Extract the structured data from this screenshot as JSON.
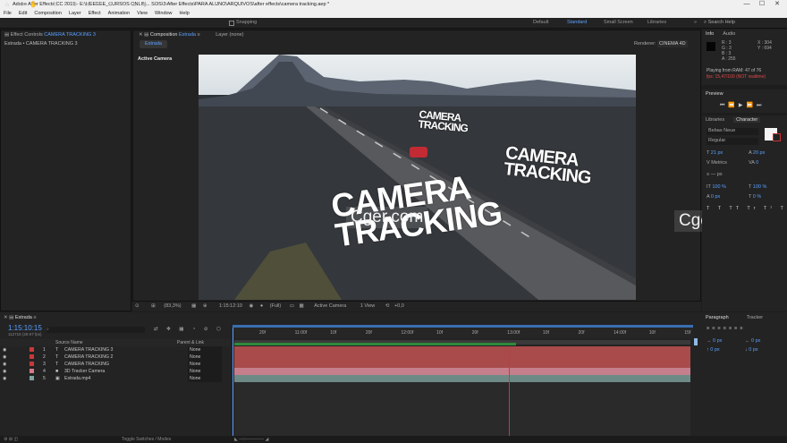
{
  "window": {
    "title": "Adobe After Effects CC 2019 - E:\\HEEEEE_CURSOS ONLIN... SOS\\3 After Effects\\PARA ALUNO\\ARQUIVOS\\after effects\\camera tracking.aep *",
    "logo": "Ae",
    "min": "—",
    "max": "☐",
    "close": "✕"
  },
  "menu": [
    "File",
    "Edit",
    "Composition",
    "Layer",
    "Effect",
    "Animation",
    "View",
    "Window",
    "Help"
  ],
  "toolbar": {
    "snapping": "Snapping",
    "workspaces": [
      "Default",
      "Standard",
      "Small Screen",
      "Libraries"
    ],
    "active_ws": "Standard",
    "search_placeholder": "Search Help"
  },
  "left_panel": {
    "tab_prefix": "Effect Controls",
    "tab_name": "CAMERA TRACKING 3",
    "subtitle": "Estrada • CAMERA TRACKING 3"
  },
  "comp_panel": {
    "tab_prefix": "Composition",
    "tab_name": "Estrada",
    "layer_tab": "Layer (none)",
    "subtab": "Estrada",
    "renderer_label": "Renderer:",
    "renderer": "CINEMA 4D",
    "active_camera": "Active Camera"
  },
  "viewer": {
    "text_large": [
      "CAMERA",
      "TRACKING"
    ],
    "text_mid": [
      "CAMERA",
      "TRACKING"
    ],
    "text_small": [
      "CAMERA",
      "TRACKING"
    ],
    "watermark_center": "Cger.com",
    "watermark_right": "Cger.com"
  },
  "viewer_controls": {
    "zoom": "(83,3%)",
    "time": "1:15:12:10",
    "resolution": "(Full)",
    "camera": "Active Camera",
    "views": "1 View",
    "exposure": "+0,0"
  },
  "info_panel": {
    "tab": "Info",
    "tab2": "Audio",
    "r": "R : 3",
    "g": "G : 3",
    "b": "B : 3",
    "a": "A : 255",
    "x": "X : 304",
    "y": "Y : 694",
    "line1": "Playing from RAM: 47 of 76",
    "line2": "fps: 15,47/100 (NOT realtime)"
  },
  "preview_panel": {
    "tab": "Preview"
  },
  "character_panel": {
    "tab_lib": "Libraries",
    "tab": "Character",
    "font": "Bebas Neue",
    "style": "Regular",
    "size": "21 px",
    "leading": "20 px",
    "tracking": "0",
    "kerning": "Metrics",
    "stroke": "— px",
    "vscale": "100 %",
    "hscale": "100 %",
    "baseline": "0 px",
    "tsume": "0 %"
  },
  "paragraph_panel": {
    "tab": "Paragraph",
    "tab2": "Tracker",
    "indent_left": "0 px",
    "indent_right": "0 px",
    "space_before": "0 px",
    "space_after": "0 px"
  },
  "timeline": {
    "comp_tab": "Estrada",
    "timecode": "1:15:10:15",
    "frames": "112715 (29.97 fps)",
    "col_source": "Source Name",
    "col_parent": "Parent & Link",
    "layers": [
      {
        "num": "1",
        "type": "T",
        "name": "CAMERA TRACKING 3",
        "parent": "None",
        "color": "#c83a3a",
        "bar": "#a94b4b"
      },
      {
        "num": "2",
        "type": "T",
        "name": "CAMERA TRACKING 2",
        "parent": "None",
        "color": "#c83a3a",
        "bar": "#a94b4b"
      },
      {
        "num": "3",
        "type": "T",
        "name": "CAMERA TRACKING",
        "parent": "None",
        "color": "#c83a3a",
        "bar": "#a94b4b"
      },
      {
        "num": "4",
        "type": "■",
        "name": "3D Tracker Camera",
        "parent": "None",
        "color": "#d47a88",
        "bar": "#c57f8c"
      },
      {
        "num": "5",
        "type": "▣",
        "name": "Estrada.mp4",
        "parent": "None",
        "color": "#7fa3a0",
        "bar": "#6e8a87"
      }
    ],
    "ruler": [
      "20f",
      "11:00f",
      "10f",
      "20f",
      "12:00f",
      "10f",
      "20f",
      "13:00f",
      "10f",
      "20f",
      "14:00f",
      "10f",
      "15f"
    ],
    "toggle": "Toggle Switches / Modes"
  },
  "colors": {
    "accent": "#2d8ceb",
    "red_layer": "#a94b4b",
    "teal_layer": "#6e8a87",
    "playhead": "#e03030"
  }
}
